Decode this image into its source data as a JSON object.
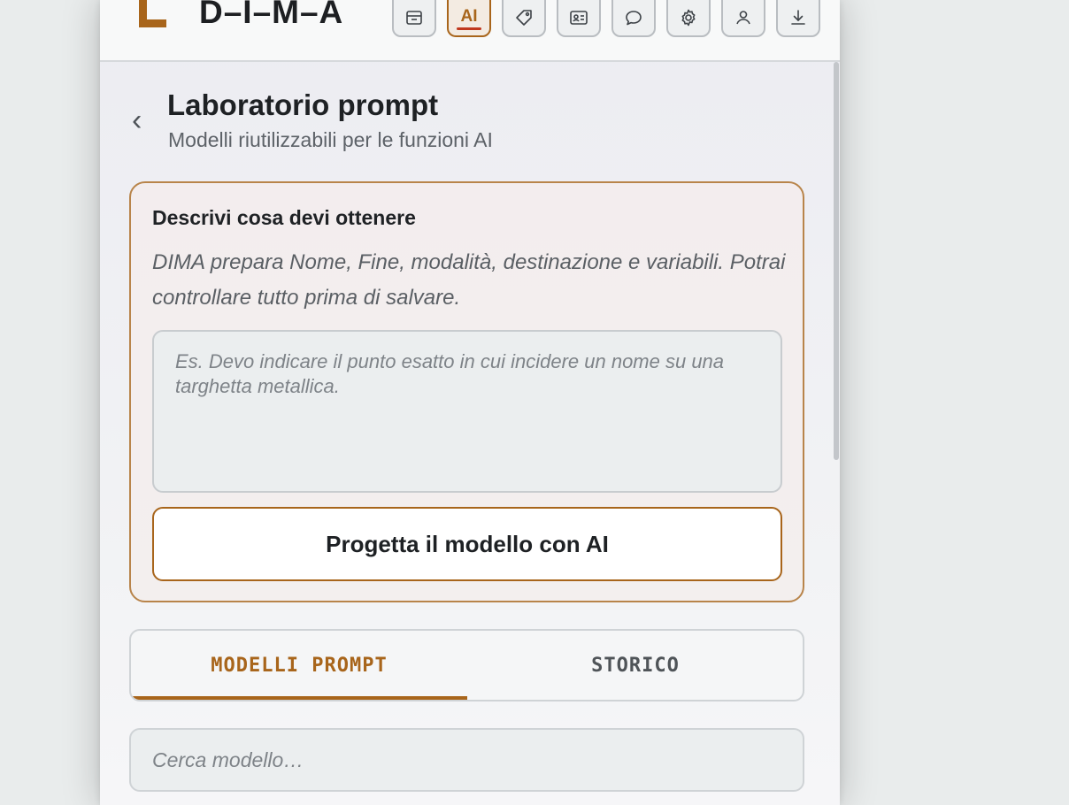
{
  "brand": {
    "name": "D–I–M–A"
  },
  "toolbar": {
    "buttons": [
      {
        "name": "archive",
        "icon": "archive-icon"
      },
      {
        "name": "ai",
        "label": "AI",
        "icon": "ai-icon",
        "active": true
      },
      {
        "name": "tag",
        "icon": "tag-icon"
      },
      {
        "name": "contact-card",
        "icon": "id-card-icon"
      },
      {
        "name": "chat",
        "icon": "chat-bubble-icon"
      },
      {
        "name": "settings",
        "icon": "gear-icon"
      },
      {
        "name": "user",
        "icon": "user-icon"
      },
      {
        "name": "download",
        "icon": "download-icon"
      }
    ]
  },
  "header": {
    "back_glyph": "‹",
    "title": "Laboratorio prompt",
    "subtitle": "Modelli riutilizzabili per le funzioni AI"
  },
  "card": {
    "heading": "Descrivi cosa devi ottenere",
    "description": "DIMA prepara Nome, Fine, modalità, destinazione e variabili. Potrai controllare tutto prima di salvare.",
    "textarea_value": "",
    "textarea_placeholder": "Es. Devo indicare il punto esatto in cui incidere un nome su una targhetta metallica.",
    "button_label": "Progetta il modello con AI"
  },
  "tabs": {
    "items": [
      {
        "label": "MODELLI PROMPT",
        "active": true
      },
      {
        "label": "STORICO",
        "active": false
      }
    ]
  },
  "search": {
    "value": "",
    "placeholder": "Cerca modello…"
  },
  "colors": {
    "accent": "#a8651b",
    "accent_underline": "#c0391f",
    "text": "#1e2124",
    "muted": "#5d6268"
  }
}
